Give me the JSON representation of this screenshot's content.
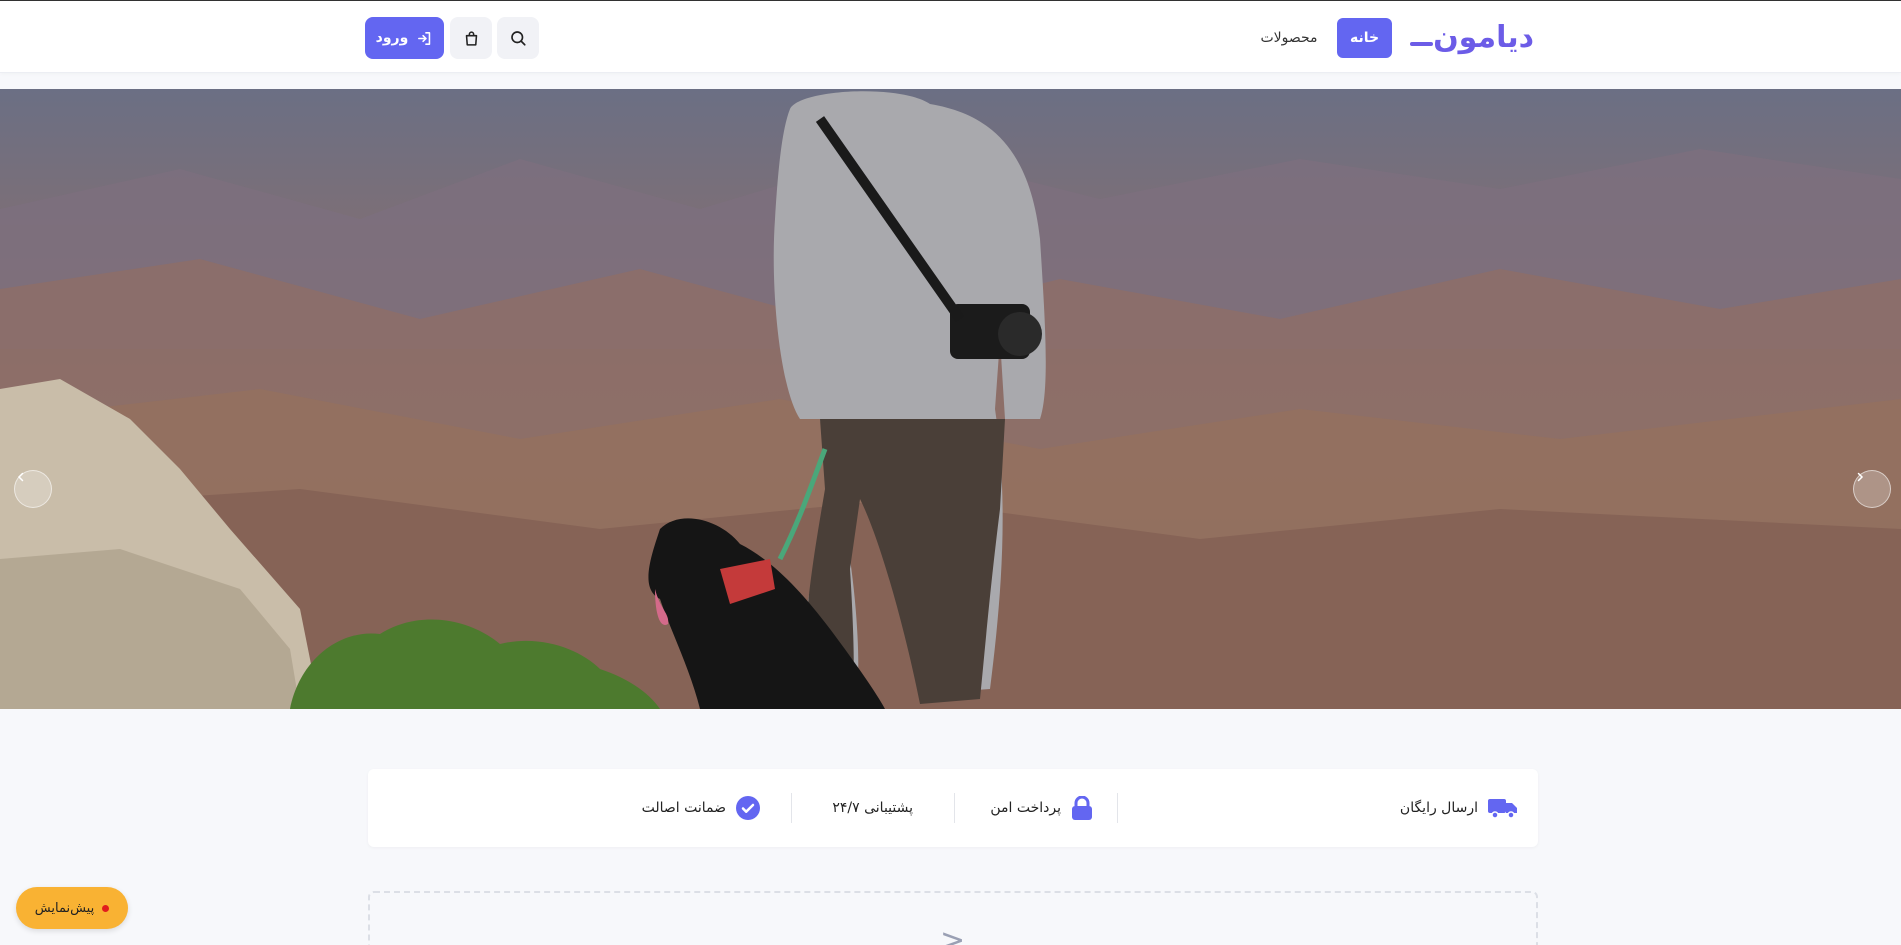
{
  "header": {
    "logo_text": "دیامون",
    "nav": {
      "home": "خانه",
      "products": "محصولات"
    },
    "login_label": "ورود"
  },
  "hero": {
    "slide_count": 3,
    "active_slide": 3
  },
  "features": [
    {
      "label": "ارسال رایگان",
      "icon": "truck-icon"
    },
    {
      "label": "پرداخت امن",
      "icon": "lock-icon"
    },
    {
      "label": "پشتیبانی ۲۴/۷",
      "icon": ""
    },
    {
      "label": "ضمانت اصالت",
      "icon": "check-circle-icon"
    }
  ],
  "placeholder_section": {
    "chevron": ">"
  },
  "preview_badge": {
    "label": "پیش‌نمایش"
  },
  "colors": {
    "accent": "#6366f1",
    "logo": "#6c5ce7",
    "preview_badge": "#f9b233",
    "preview_dot": "#e11d1d"
  }
}
